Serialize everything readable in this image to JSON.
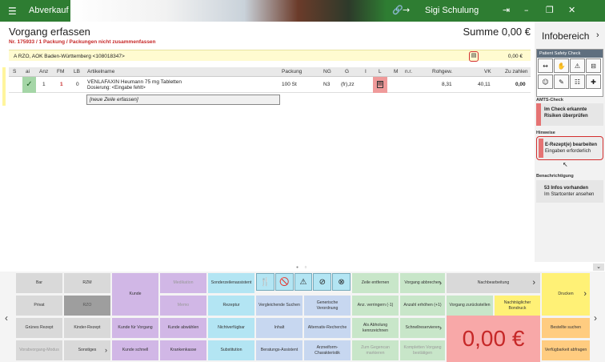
{
  "titlebar": {
    "menu_icon": "hamburger-icon",
    "title": "Abverkauf",
    "user": "Sigi Schulung"
  },
  "main": {
    "title": "Vorgang erfassen",
    "sum": "Summe 0,00 €",
    "vorgang_info": "Nr. 175933 / 1 Packung / Packungen nicht zusammenfassen"
  },
  "customer": {
    "line": "A  RZO, AOK Baden-Württemberg <108018347>",
    "amount": "0,00 €"
  },
  "grid": {
    "headers": [
      "S",
      "ai",
      "Anz",
      "FM",
      "LB",
      "Artikelname",
      "Packung",
      "NG",
      "G",
      "I",
      "L",
      "M",
      "n.r.",
      "Rohgew.",
      "VK",
      "Zu zahlen"
    ],
    "row": {
      "anz": "1",
      "fm": "1",
      "lb": "0",
      "name": "VENLAFAXIN Heumann 75 mg Tabletten",
      "dosage": "Dosierung: <Eingabe fehlt>",
      "packung": "100 St",
      "ng": "N3",
      "g": "(fr),zz",
      "rohgew": "8,31",
      "vk": "40,11",
      "zu_zahlen": "0,00"
    },
    "new_row_placeholder": "[neue Zeile erfassen]"
  },
  "info": {
    "title": "Infobereich",
    "psc_title": "Patient Safety Check",
    "amts_label": "AMTS-Check",
    "amts_text1": "Im Check erkannte",
    "amts_text2": "Risiken überprüfen",
    "hinweise_label": "Hinweise",
    "hinweis_text1": "E-Rezept(e) bearbeiten",
    "hinweis_text2": "Eingaben erforderlich",
    "benachr_label": "Benachrichtigung",
    "benachr_text1": "53  Infos vorhanden",
    "benachr_text2": "Im Startcenter ansehen"
  },
  "buttons": {
    "bar": "Bar",
    "rzm": "RZM",
    "kunde": "Kunde",
    "medikation": "Medikation",
    "sonderzeilen": "Sonderzeilenassistent",
    "zeile_entfernen": "Zeile entfernen",
    "vorgang_abbrechen": "Vorgang abbrechen",
    "nachbearbeitung": "Nachbearbeitung",
    "drucken": "Drucken",
    "privat": "Privat",
    "rzo": "RZO",
    "memo": "Memo",
    "rezeptur": "Rezeptur",
    "vergl_suchen": "Vergleichende Suchen",
    "generische": "Generische Verordnung",
    "anz_verringern": "Anz. verringern (-1)",
    "anzahl_erhoehen": "Anzahl erhöhen (+1)",
    "vorgang_zurueck": "Vorgang zurückstellen",
    "nachtr_bondruck": "Nachträglicher Bondruck",
    "gruenes_rezept": "Grünes Rezept",
    "kinder_rezept": "Kinder-Rezept",
    "kunde_fuer_vorgang": "Kunde für Vorgang",
    "kunde_abwaehlen": "Kunde abwählen",
    "nichtverfuegbar": "Nichtverfügbar",
    "inhalt": "Inhalt",
    "alternativ": "Alternativ-Recherche",
    "als_abholung": "Als Abholung kennzeichnen",
    "schnellreserv": "Schnellreservieren",
    "bestellte_suchen": "Bestellte suchen",
    "vorab_modus": "Vorabvorgang-Modus",
    "sonstiges": "Sonstiges",
    "kunde_schnell": "Kunde schnell",
    "krankenkasse": "Krankenkasse",
    "substitution": "Substitution",
    "beratungs": "Beratungs-Assistent",
    "arzneiform": "Arzneiform-Charakteristik",
    "zum_gegencan": "Zum Gegencan markieren",
    "komplett_vorgang": "Kompletten Vorgang bestätigen",
    "verfuegbarkeit": "Verfügbarkeit abfragen",
    "big_sum": "0,00 €"
  }
}
